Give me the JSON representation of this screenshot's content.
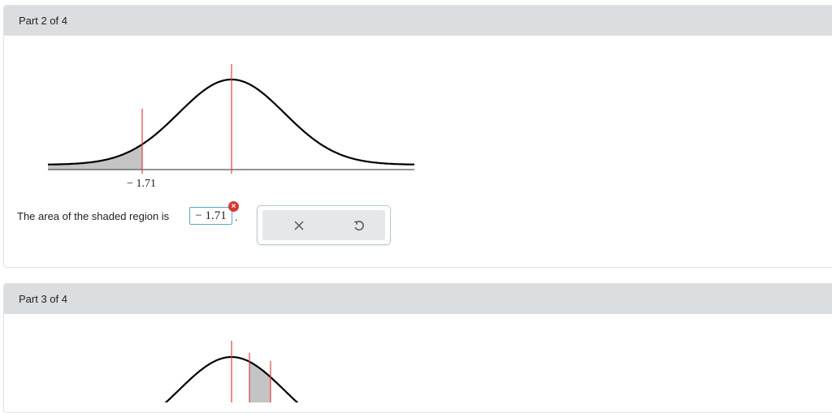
{
  "part2": {
    "header": "Part 2 of 4",
    "tick_label": "− 1.71",
    "question": "The area of the shaded region is",
    "answer_value": "− 1.71",
    "period": ".",
    "error_icon": "×",
    "tools": {
      "clear_icon": "close-icon",
      "undo_icon": "undo-icon"
    }
  },
  "part3": {
    "header": "Part 3 of 4"
  },
  "colors": {
    "marker_line": "#e0443c",
    "shade": "#c4c4c4",
    "error": "#d43a36",
    "answer_border": "#5aa5c8",
    "header_bg": "#dbdee0"
  }
}
